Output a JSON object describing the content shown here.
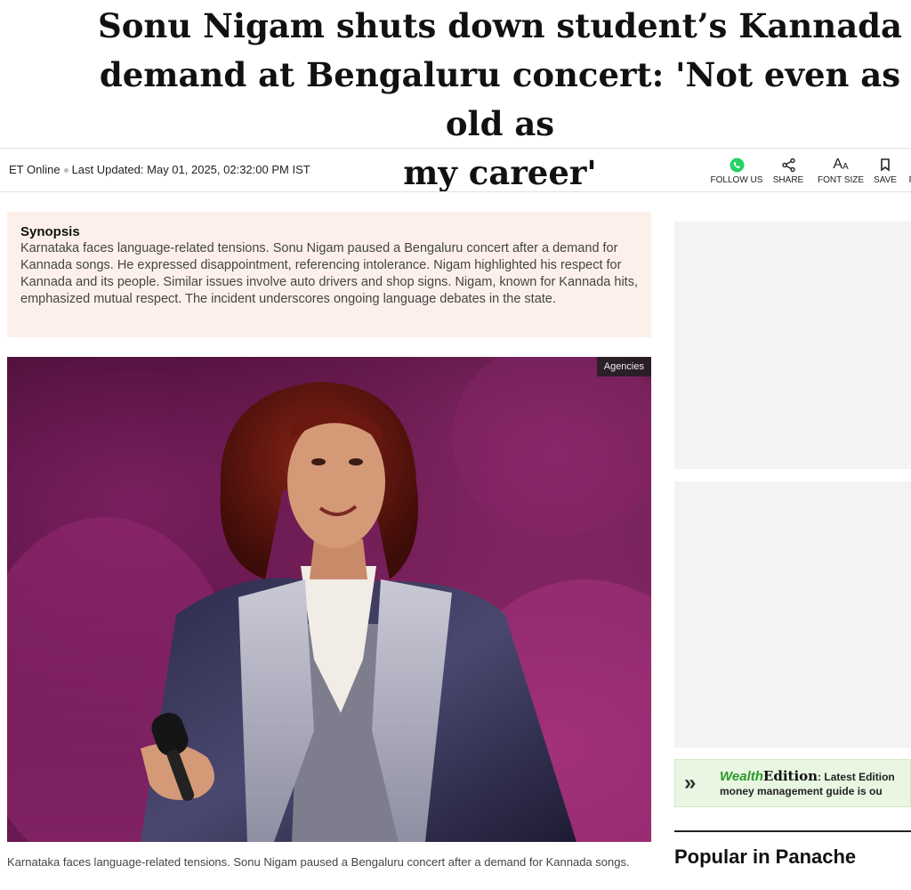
{
  "article": {
    "headline": "Sonu Nigam shuts down student’s Kannada\ndemand at Bengaluru concert: 'Not even as old as\nmy career'",
    "source": "ET Online",
    "last_updated": "Last Updated: May 01, 2025, 02:32:00 PM IST"
  },
  "toolbar": {
    "follow_label": "FOLLOW US",
    "share_label": "SHARE",
    "font_size_label": "FONT SIZE",
    "font_size_glyph": "AA",
    "save_label": "SAVE",
    "more_label": "P"
  },
  "synopsis": {
    "heading": "Synopsis",
    "text": "Karnataka faces language-related tensions. Sonu Nigam paused a Bengaluru concert after a demand for Kannada songs. He expressed disappointment, referencing intolerance. Nigam highlighted his respect for Kannada and its people. Similar issues involve auto drivers and shop signs. Nigam, known for Kannada hits, emphasized mutual respect. The incident underscores ongoing language debates in the state."
  },
  "image": {
    "credit": "Agencies",
    "caption": "Karnataka faces language-related tensions. Sonu Nigam paused a Bengaluru concert after a demand for Kannada songs."
  },
  "sidebar": {
    "wealth": {
      "brand": "Wealth",
      "edition": "Edition",
      "line1_rest": ": Latest Edition",
      "line2": "money management guide is ou"
    },
    "popular_title": "Popular in Panache"
  },
  "icons": {
    "follow": "whatsapp-icon",
    "share": "share-icon",
    "font": "font-size-icon",
    "save": "bookmark-icon"
  },
  "colors": {
    "synopsis_bg": "#fdf0ea",
    "whatsapp_green": "#25d366",
    "wealth_green": "#2a9a2a"
  }
}
